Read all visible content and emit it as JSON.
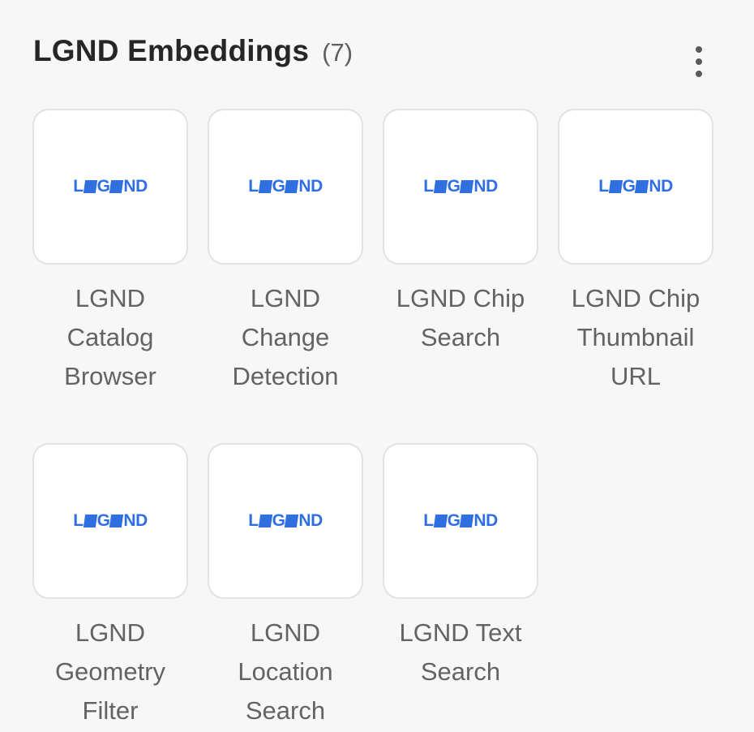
{
  "section": {
    "title": "LGND Embeddings",
    "count": "(7)"
  },
  "logo": {
    "text_left": "L",
    "text_mid": "G",
    "text_right": "ND",
    "color": "#2f6fe0"
  },
  "tiles": [
    {
      "label": "LGND Catalog Browser"
    },
    {
      "label": "LGND Change Detection"
    },
    {
      "label": "LGND Chip Search"
    },
    {
      "label": "LGND Chip Thumbnail URL"
    },
    {
      "label": "LGND Geometry Filter"
    },
    {
      "label": "LGND Location Search"
    },
    {
      "label": "LGND Text Search"
    }
  ]
}
